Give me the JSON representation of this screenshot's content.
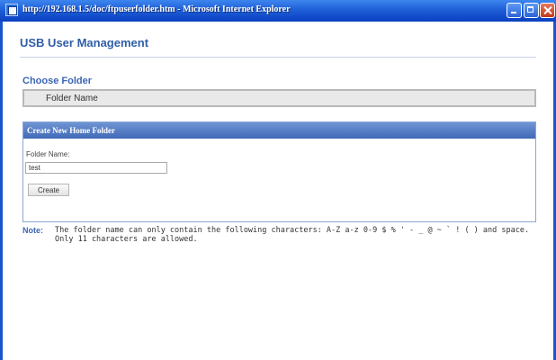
{
  "window": {
    "title": "http://192.168.1.5/doc/ftpuserfolder.htm - Microsoft Internet Explorer"
  },
  "page": {
    "title": "USB User Management"
  },
  "choose_folder": {
    "title": "Choose Folder",
    "column_header": "Folder Name"
  },
  "create_panel": {
    "header": "Create New Home Folder",
    "field_label": "Folder Name:",
    "field_value": "test",
    "button_label": "Create"
  },
  "note": {
    "label": "Note:",
    "text": "The folder name can only contain the following characters: A-Z a-z 0-9 $ % ' - _ @ ~ ` ! ( ) and space. Only 11 characters are allowed."
  },
  "icons": {
    "window_icon": "ie-page-icon",
    "minimize": "minimize-icon",
    "maximize": "maximize-icon",
    "close": "close-icon"
  },
  "colors": {
    "titlebar": "#1f5fd8",
    "heading": "#2f5ea8",
    "panel_header": "#4068b8",
    "close_button": "#c0391a"
  }
}
